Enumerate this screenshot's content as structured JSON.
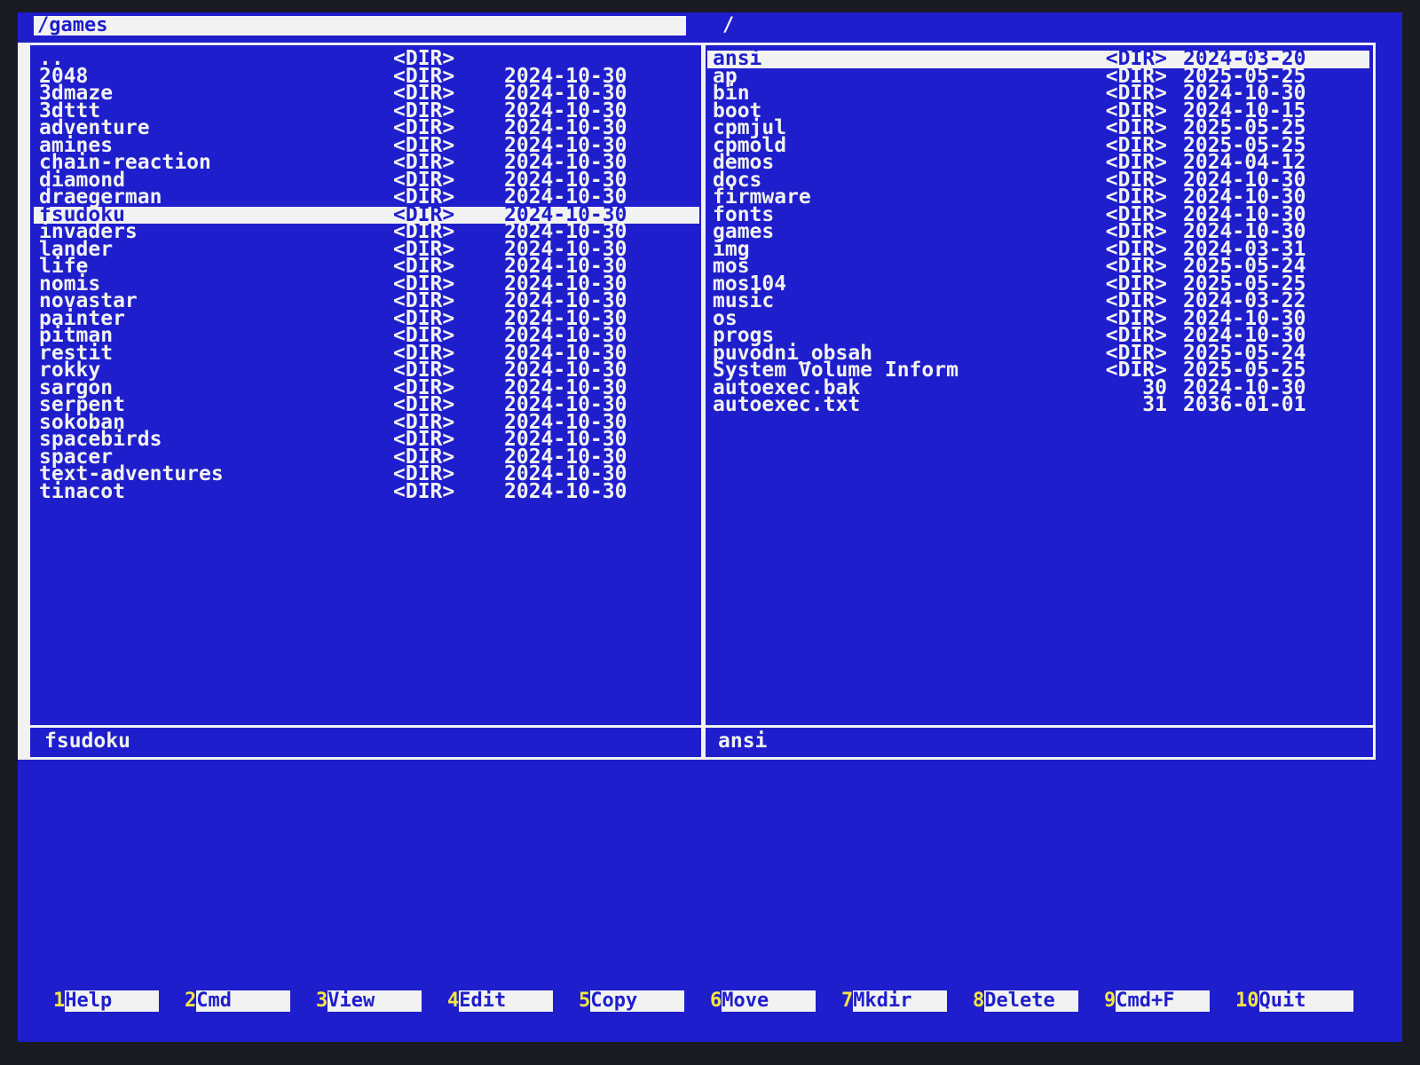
{
  "left_panel": {
    "path": "/games",
    "status": "fsudoku",
    "entries": [
      {
        "name": "..",
        "size": "<DIR>",
        "date": "",
        "selected": false
      },
      {
        "name": "2048",
        "size": "<DIR>",
        "date": "2024-10-30",
        "selected": false
      },
      {
        "name": "3dmaze",
        "size": "<DIR>",
        "date": "2024-10-30",
        "selected": false
      },
      {
        "name": "3dttt",
        "size": "<DIR>",
        "date": "2024-10-30",
        "selected": false
      },
      {
        "name": "adventure",
        "size": "<DIR>",
        "date": "2024-10-30",
        "selected": false
      },
      {
        "name": "amines",
        "size": "<DIR>",
        "date": "2024-10-30",
        "selected": false
      },
      {
        "name": "chain-reaction",
        "size": "<DIR>",
        "date": "2024-10-30",
        "selected": false
      },
      {
        "name": "diamond",
        "size": "<DIR>",
        "date": "2024-10-30",
        "selected": false
      },
      {
        "name": "draegerman",
        "size": "<DIR>",
        "date": "2024-10-30",
        "selected": false
      },
      {
        "name": "fsudoku",
        "size": "<DIR>",
        "date": "2024-10-30",
        "selected": true
      },
      {
        "name": "invaders",
        "size": "<DIR>",
        "date": "2024-10-30",
        "selected": false
      },
      {
        "name": "lander",
        "size": "<DIR>",
        "date": "2024-10-30",
        "selected": false
      },
      {
        "name": "life",
        "size": "<DIR>",
        "date": "2024-10-30",
        "selected": false
      },
      {
        "name": "nomis",
        "size": "<DIR>",
        "date": "2024-10-30",
        "selected": false
      },
      {
        "name": "novastar",
        "size": "<DIR>",
        "date": "2024-10-30",
        "selected": false
      },
      {
        "name": "painter",
        "size": "<DIR>",
        "date": "2024-10-30",
        "selected": false
      },
      {
        "name": "pitman",
        "size": "<DIR>",
        "date": "2024-10-30",
        "selected": false
      },
      {
        "name": "restit",
        "size": "<DIR>",
        "date": "2024-10-30",
        "selected": false
      },
      {
        "name": "rokky",
        "size": "<DIR>",
        "date": "2024-10-30",
        "selected": false
      },
      {
        "name": "sargon",
        "size": "<DIR>",
        "date": "2024-10-30",
        "selected": false
      },
      {
        "name": "serpent",
        "size": "<DIR>",
        "date": "2024-10-30",
        "selected": false
      },
      {
        "name": "sokoban",
        "size": "<DIR>",
        "date": "2024-10-30",
        "selected": false
      },
      {
        "name": "spacebirds",
        "size": "<DIR>",
        "date": "2024-10-30",
        "selected": false
      },
      {
        "name": "spacer",
        "size": "<DIR>",
        "date": "2024-10-30",
        "selected": false
      },
      {
        "name": "text-adventures",
        "size": "<DIR>",
        "date": "2024-10-30",
        "selected": false
      },
      {
        "name": "tinacot",
        "size": "<DIR>",
        "date": "2024-10-30",
        "selected": false
      }
    ]
  },
  "right_panel": {
    "path": "/",
    "status": "ansi",
    "entries": [
      {
        "name": "ansi",
        "size": "<DIR>",
        "date": "2024-03-20",
        "selected": true
      },
      {
        "name": "ap",
        "size": "<DIR>",
        "date": "2025-05-25",
        "selected": false
      },
      {
        "name": "bin",
        "size": "<DIR>",
        "date": "2024-10-30",
        "selected": false
      },
      {
        "name": "boot",
        "size": "<DIR>",
        "date": "2024-10-15",
        "selected": false
      },
      {
        "name": "cpmjul",
        "size": "<DIR>",
        "date": "2025-05-25",
        "selected": false
      },
      {
        "name": "cpmold",
        "size": "<DIR>",
        "date": "2025-05-25",
        "selected": false
      },
      {
        "name": "demos",
        "size": "<DIR>",
        "date": "2024-04-12",
        "selected": false
      },
      {
        "name": "docs",
        "size": "<DIR>",
        "date": "2024-10-30",
        "selected": false
      },
      {
        "name": "firmware",
        "size": "<DIR>",
        "date": "2024-10-30",
        "selected": false
      },
      {
        "name": "fonts",
        "size": "<DIR>",
        "date": "2024-10-30",
        "selected": false
      },
      {
        "name": "games",
        "size": "<DIR>",
        "date": "2024-10-30",
        "selected": false
      },
      {
        "name": "img",
        "size": "<DIR>",
        "date": "2024-03-31",
        "selected": false
      },
      {
        "name": "mos",
        "size": "<DIR>",
        "date": "2025-05-24",
        "selected": false
      },
      {
        "name": "mos104",
        "size": "<DIR>",
        "date": "2025-05-25",
        "selected": false
      },
      {
        "name": "music",
        "size": "<DIR>",
        "date": "2024-03-22",
        "selected": false
      },
      {
        "name": "os",
        "size": "<DIR>",
        "date": "2024-10-30",
        "selected": false
      },
      {
        "name": "progs",
        "size": "<DIR>",
        "date": "2024-10-30",
        "selected": false
      },
      {
        "name": "puvodni_obsah",
        "size": "<DIR>",
        "date": "2025-05-24",
        "selected": false
      },
      {
        "name": "System Volume Inform",
        "size": "<DIR>",
        "date": "2025-05-25",
        "selected": false
      },
      {
        "name": "autoexec.bak",
        "size": "30",
        "date": "2024-10-30",
        "selected": false
      },
      {
        "name": "autoexec.txt",
        "size": "31",
        "date": "2036-01-01",
        "selected": false
      }
    ]
  },
  "function_keys": [
    {
      "num": "1",
      "label": "Help"
    },
    {
      "num": "2",
      "label": "Cmd"
    },
    {
      "num": "3",
      "label": "View"
    },
    {
      "num": "4",
      "label": "Edit"
    },
    {
      "num": "5",
      "label": "Copy"
    },
    {
      "num": "6",
      "label": "Move"
    },
    {
      "num": "7",
      "label": "Mkdir"
    },
    {
      "num": "8",
      "label": "Delete"
    },
    {
      "num": "9",
      "label": "Cmd+F"
    },
    {
      "num": "10",
      "label": "Quit"
    }
  ],
  "colors": {
    "background": "#1e1ecc",
    "foreground": "#f2f2f2",
    "fkey_number": "#f5e642"
  }
}
